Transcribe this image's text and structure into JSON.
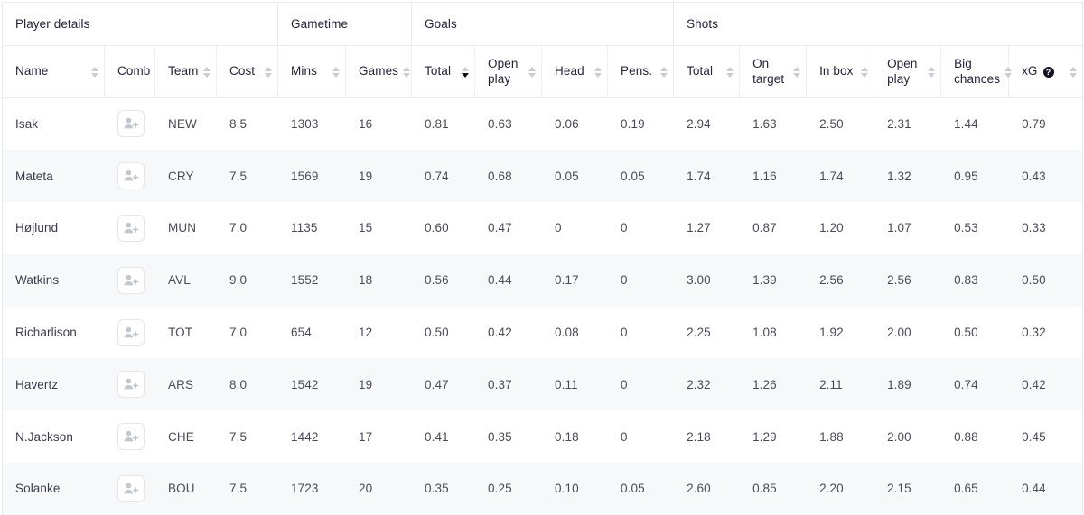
{
  "table": {
    "groups": [
      {
        "label": "Player details",
        "span": 4
      },
      {
        "label": "Gametime",
        "span": 2
      },
      {
        "label": "Goals",
        "span": 4
      },
      {
        "label": "Shots",
        "span": 6
      }
    ],
    "columns": [
      {
        "label": "Name",
        "sortable": true,
        "sort": "none",
        "help": false
      },
      {
        "label": "Comb",
        "sortable": false,
        "sort": "none",
        "help": false
      },
      {
        "label": "Team",
        "sortable": true,
        "sort": "none",
        "help": false
      },
      {
        "label": "Cost",
        "sortable": true,
        "sort": "none",
        "help": false
      },
      {
        "label": "Mins",
        "sortable": true,
        "sort": "none",
        "help": false
      },
      {
        "label": "Games",
        "sortable": true,
        "sort": "none",
        "help": false
      },
      {
        "label": "Total",
        "sortable": true,
        "sort": "desc",
        "help": false
      },
      {
        "label": "Open\nplay",
        "sortable": true,
        "sort": "none",
        "help": false
      },
      {
        "label": "Head",
        "sortable": true,
        "sort": "none",
        "help": false
      },
      {
        "label": "Pens.",
        "sortable": true,
        "sort": "none",
        "help": false
      },
      {
        "label": "Total",
        "sortable": true,
        "sort": "none",
        "help": false
      },
      {
        "label": "On\ntarget",
        "sortable": true,
        "sort": "none",
        "help": false
      },
      {
        "label": "In box",
        "sortable": true,
        "sort": "none",
        "help": false
      },
      {
        "label": "Open\nplay",
        "sortable": true,
        "sort": "none",
        "help": false
      },
      {
        "label": "Big\nchances",
        "sortable": true,
        "sort": "none",
        "help": false
      },
      {
        "label": "xG",
        "sortable": true,
        "sort": "none",
        "help": true
      }
    ],
    "help_glyph": "?",
    "comb_icon": "add-person-icon",
    "rows": [
      {
        "name": "Isak",
        "team": "NEW",
        "cost": "8.5",
        "mins": "1303",
        "games": "16",
        "goals_total": "0.81",
        "goals_open_play": "0.63",
        "goals_head": "0.06",
        "goals_pens": "0.19",
        "shots_total": "2.94",
        "shots_on_target": "1.63",
        "shots_in_box": "2.50",
        "shots_open_play": "2.31",
        "shots_big_chances": "1.44",
        "xg": "0.79"
      },
      {
        "name": "Mateta",
        "team": "CRY",
        "cost": "7.5",
        "mins": "1569",
        "games": "19",
        "goals_total": "0.74",
        "goals_open_play": "0.68",
        "goals_head": "0.05",
        "goals_pens": "0.05",
        "shots_total": "1.74",
        "shots_on_target": "1.16",
        "shots_in_box": "1.74",
        "shots_open_play": "1.32",
        "shots_big_chances": "0.95",
        "xg": "0.43"
      },
      {
        "name": "Højlund",
        "team": "MUN",
        "cost": "7.0",
        "mins": "1135",
        "games": "15",
        "goals_total": "0.60",
        "goals_open_play": "0.47",
        "goals_head": "0",
        "goals_pens": "0",
        "shots_total": "1.27",
        "shots_on_target": "0.87",
        "shots_in_box": "1.20",
        "shots_open_play": "1.07",
        "shots_big_chances": "0.53",
        "xg": "0.33"
      },
      {
        "name": "Watkins",
        "team": "AVL",
        "cost": "9.0",
        "mins": "1552",
        "games": "18",
        "goals_total": "0.56",
        "goals_open_play": "0.44",
        "goals_head": "0.17",
        "goals_pens": "0",
        "shots_total": "3.00",
        "shots_on_target": "1.39",
        "shots_in_box": "2.56",
        "shots_open_play": "2.56",
        "shots_big_chances": "0.83",
        "xg": "0.50"
      },
      {
        "name": "Richarlison",
        "team": "TOT",
        "cost": "7.0",
        "mins": "654",
        "games": "12",
        "goals_total": "0.50",
        "goals_open_play": "0.42",
        "goals_head": "0.08",
        "goals_pens": "0",
        "shots_total": "2.25",
        "shots_on_target": "1.08",
        "shots_in_box": "1.92",
        "shots_open_play": "2.00",
        "shots_big_chances": "0.50",
        "xg": "0.32"
      },
      {
        "name": "Havertz",
        "team": "ARS",
        "cost": "8.0",
        "mins": "1542",
        "games": "19",
        "goals_total": "0.47",
        "goals_open_play": "0.37",
        "goals_head": "0.11",
        "goals_pens": "0",
        "shots_total": "2.32",
        "shots_on_target": "1.26",
        "shots_in_box": "2.11",
        "shots_open_play": "1.89",
        "shots_big_chances": "0.74",
        "xg": "0.42"
      },
      {
        "name": "N.Jackson",
        "team": "CHE",
        "cost": "7.5",
        "mins": "1442",
        "games": "17",
        "goals_total": "0.41",
        "goals_open_play": "0.35",
        "goals_head": "0.18",
        "goals_pens": "0",
        "shots_total": "2.18",
        "shots_on_target": "1.29",
        "shots_in_box": "1.88",
        "shots_open_play": "2.00",
        "shots_big_chances": "0.88",
        "xg": "0.45"
      },
      {
        "name": "Solanke",
        "team": "BOU",
        "cost": "7.5",
        "mins": "1723",
        "games": "20",
        "goals_total": "0.35",
        "goals_open_play": "0.25",
        "goals_head": "0.10",
        "goals_pens": "0.05",
        "shots_total": "2.60",
        "shots_on_target": "0.85",
        "shots_in_box": "2.20",
        "shots_open_play": "2.15",
        "shots_big_chances": "0.65",
        "xg": "0.44"
      }
    ]
  },
  "colors": {
    "header_text": "#242338",
    "body_text": "#4a4a57",
    "border": "#e8e9ec",
    "stripe": "#f7f8f9",
    "sort_active": "#0f0e1c",
    "sort_inactive": "#c9ccd3"
  }
}
